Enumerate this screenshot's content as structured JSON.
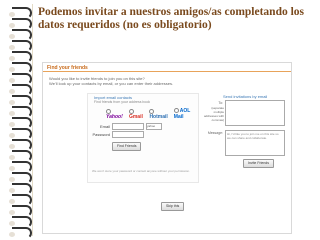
{
  "slide": {
    "title": "Podemos invitar a nuestros amigos/as completando los datos requeridos (no es obligatorio)"
  },
  "screenshot": {
    "title": "Find your friends",
    "intro": [
      "Would you like to invite friends to join you on this site?",
      "We'll look up your contacts by email, or you can enter their addresses."
    ],
    "import_panel": {
      "heading": "Import email contacts",
      "subtitle": "Find friends from your address book",
      "providers": [
        "Yahoo!",
        "Gmail",
        "Hotmail",
        "AOL Mail"
      ],
      "email_label": "Email",
      "password_label": "Password",
      "domain_value": "yahoo",
      "find_button": "Find Friends",
      "note": "We won't store your password or contact anyone without your permission."
    },
    "invite_panel": {
      "heading": "Send invitations by email",
      "to_label": "To:",
      "to_hint": "(separate multiple addresses with commas)",
      "message_label": "Message:",
      "message_text": "Hi, I'd like you to join me on this site so we can share and collaborate.",
      "invite_button": "Invite Friends"
    },
    "skip_button": "Skip this"
  }
}
